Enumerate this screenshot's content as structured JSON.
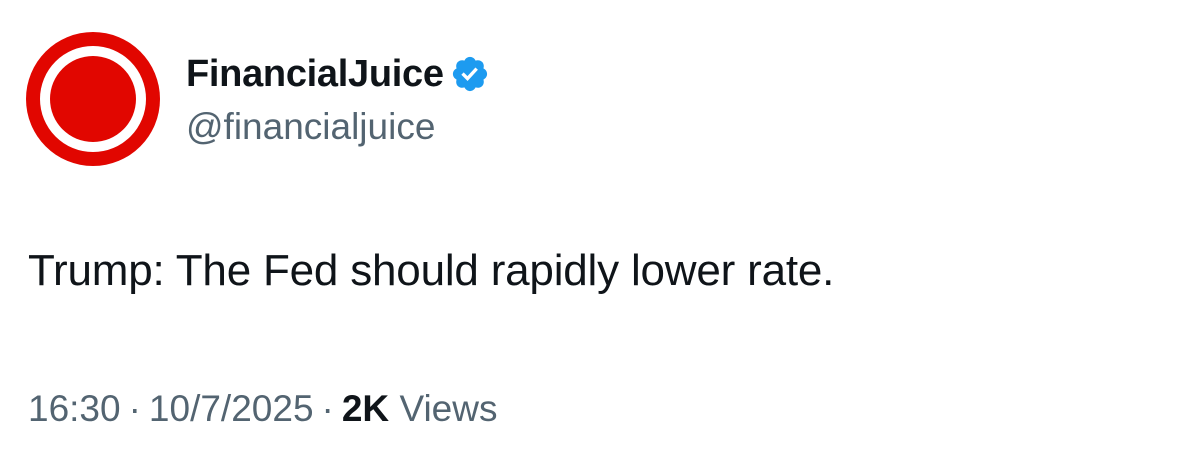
{
  "author": {
    "display_name": "FinancialJuice",
    "handle": "@financialjuice",
    "verified": true,
    "avatar_color": "#e10600",
    "verified_icon": "verified-badge-icon",
    "verified_color": "#1d9bf0"
  },
  "tweet": {
    "text": "Trump: The Fed should rapidly lower rate."
  },
  "meta": {
    "time": "16:30",
    "separator": "·",
    "date": "10/7/2025",
    "views_count": "2K",
    "views_label": "Views"
  }
}
